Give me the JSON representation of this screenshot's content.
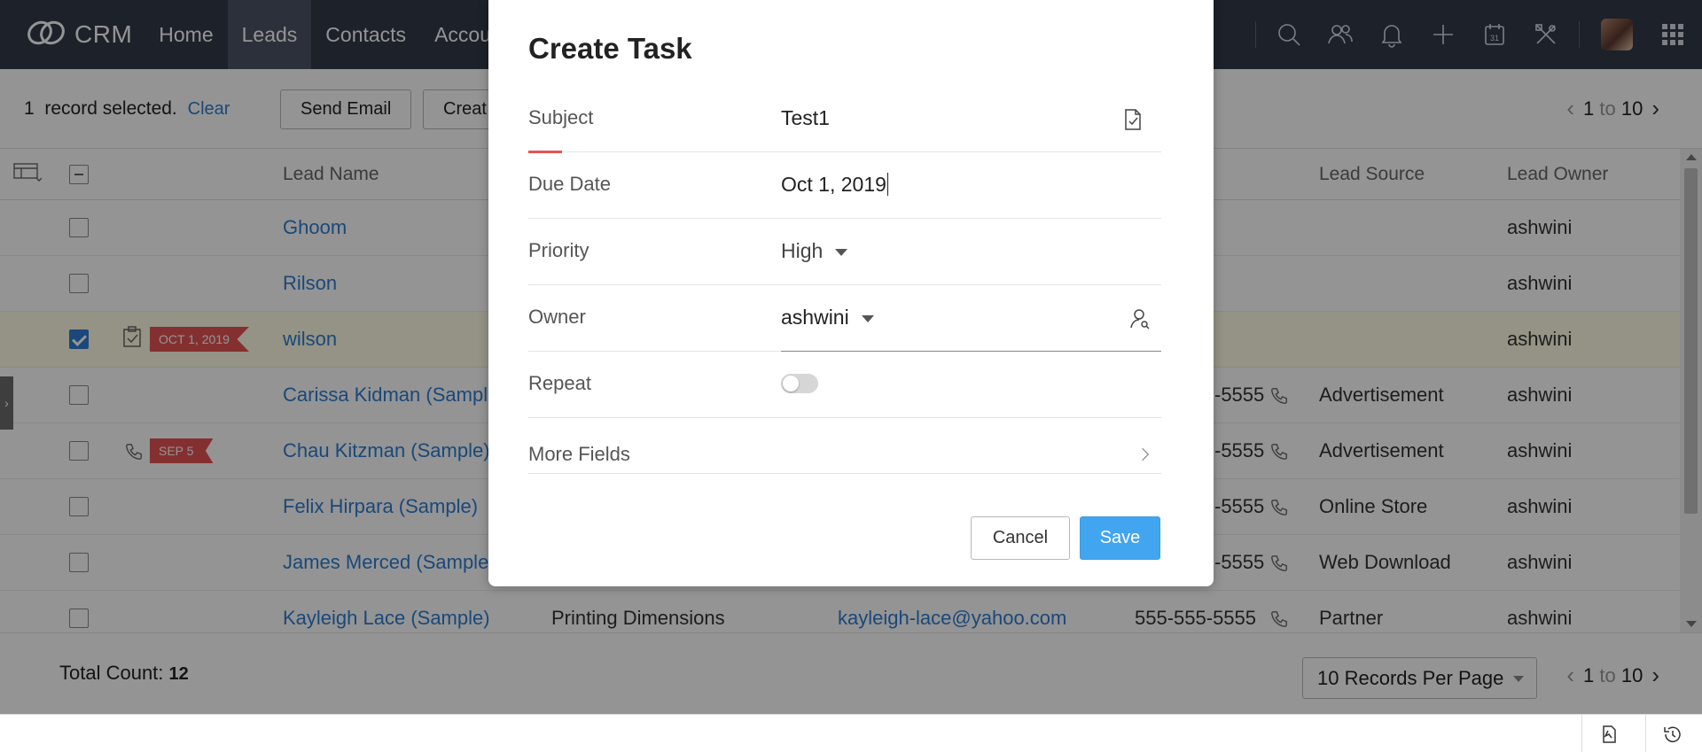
{
  "app": {
    "brand": "CRM"
  },
  "nav": {
    "tabs": [
      {
        "label": "Home",
        "active": false
      },
      {
        "label": "Leads",
        "active": true
      },
      {
        "label": "Contacts",
        "active": false
      },
      {
        "label": "Accou",
        "active": false
      }
    ],
    "icons": [
      "search-icon",
      "contacts-icon",
      "bell-icon",
      "plus-icon",
      "calendar-icon",
      "setup-tools-icon",
      "apps-grid-icon"
    ],
    "calendar_day": "31"
  },
  "actionbar": {
    "selected_count": "1",
    "selected_text": "record selected.",
    "clear_label": "Clear",
    "send_email_label": "Send Email",
    "create_label": "Creat",
    "pager": {
      "from": "1",
      "to_word": "to",
      "to": "10"
    }
  },
  "table": {
    "headers": {
      "lead_name": "Lead Name",
      "lead_source": "Lead Source",
      "lead_owner": "Lead Owner"
    },
    "rows": [
      {
        "checked": false,
        "tag": "",
        "name": "Ghoom",
        "company": "",
        "email": "",
        "phone": "",
        "source": "",
        "owner": "ashwini"
      },
      {
        "checked": false,
        "tag": "",
        "name": "Rilson",
        "company": "",
        "email": "",
        "phone": "",
        "source": "",
        "owner": "ashwini"
      },
      {
        "checked": true,
        "tag": "OCT 1, 2019",
        "name": "wilson",
        "company": "",
        "email": "",
        "phone": "",
        "source": "",
        "owner": "ashwini"
      },
      {
        "checked": false,
        "tag": "",
        "name": "Carissa Kidman (Sample",
        "company": "",
        "email": "",
        "phone": "-5555",
        "source": "Advertisement",
        "owner": "ashwini"
      },
      {
        "checked": false,
        "tag": "SEP 5",
        "name": "Chau Kitzman (Sample)",
        "company": "",
        "email": "",
        "phone": "-5555",
        "source": "Advertisement",
        "owner": "ashwini"
      },
      {
        "checked": false,
        "tag": "",
        "name": "Felix Hirpara (Sample)",
        "company": "",
        "email": "",
        "phone": "-5555",
        "source": "Online Store",
        "owner": "ashwini"
      },
      {
        "checked": false,
        "tag": "",
        "name": "James Merced (Sample)",
        "company": "",
        "email": "",
        "phone": "-5555",
        "source": "Web Download",
        "owner": "ashwini"
      },
      {
        "checked": false,
        "tag": "",
        "name": "Kayleigh Lace (Sample)",
        "company": "Printing Dimensions",
        "email": "kayleigh-lace@yahoo.com",
        "phone": "555-555-5555",
        "source": "Partner",
        "owner": "ashwini"
      }
    ]
  },
  "footer": {
    "total_label": "Total Count:",
    "total_value": "12",
    "per_page": "10 Records Per Page",
    "pager": {
      "from": "1",
      "to_word": "to",
      "to": "10"
    }
  },
  "modal": {
    "title": "Create Task",
    "fields": {
      "subject": {
        "label": "Subject",
        "value": "Test1"
      },
      "due_date": {
        "label": "Due Date",
        "value": "Oct 1, 2019"
      },
      "priority": {
        "label": "Priority",
        "value": "High"
      },
      "owner": {
        "label": "Owner",
        "value": "ashwini"
      },
      "repeat": {
        "label": "Repeat",
        "on": false
      },
      "more": {
        "label": "More Fields"
      }
    },
    "cancel_label": "Cancel",
    "save_label": "Save"
  },
  "colors": {
    "nav_bg": "#313949",
    "link": "#2d7dd2",
    "tag": "#e55353",
    "save": "#42a5f0"
  }
}
